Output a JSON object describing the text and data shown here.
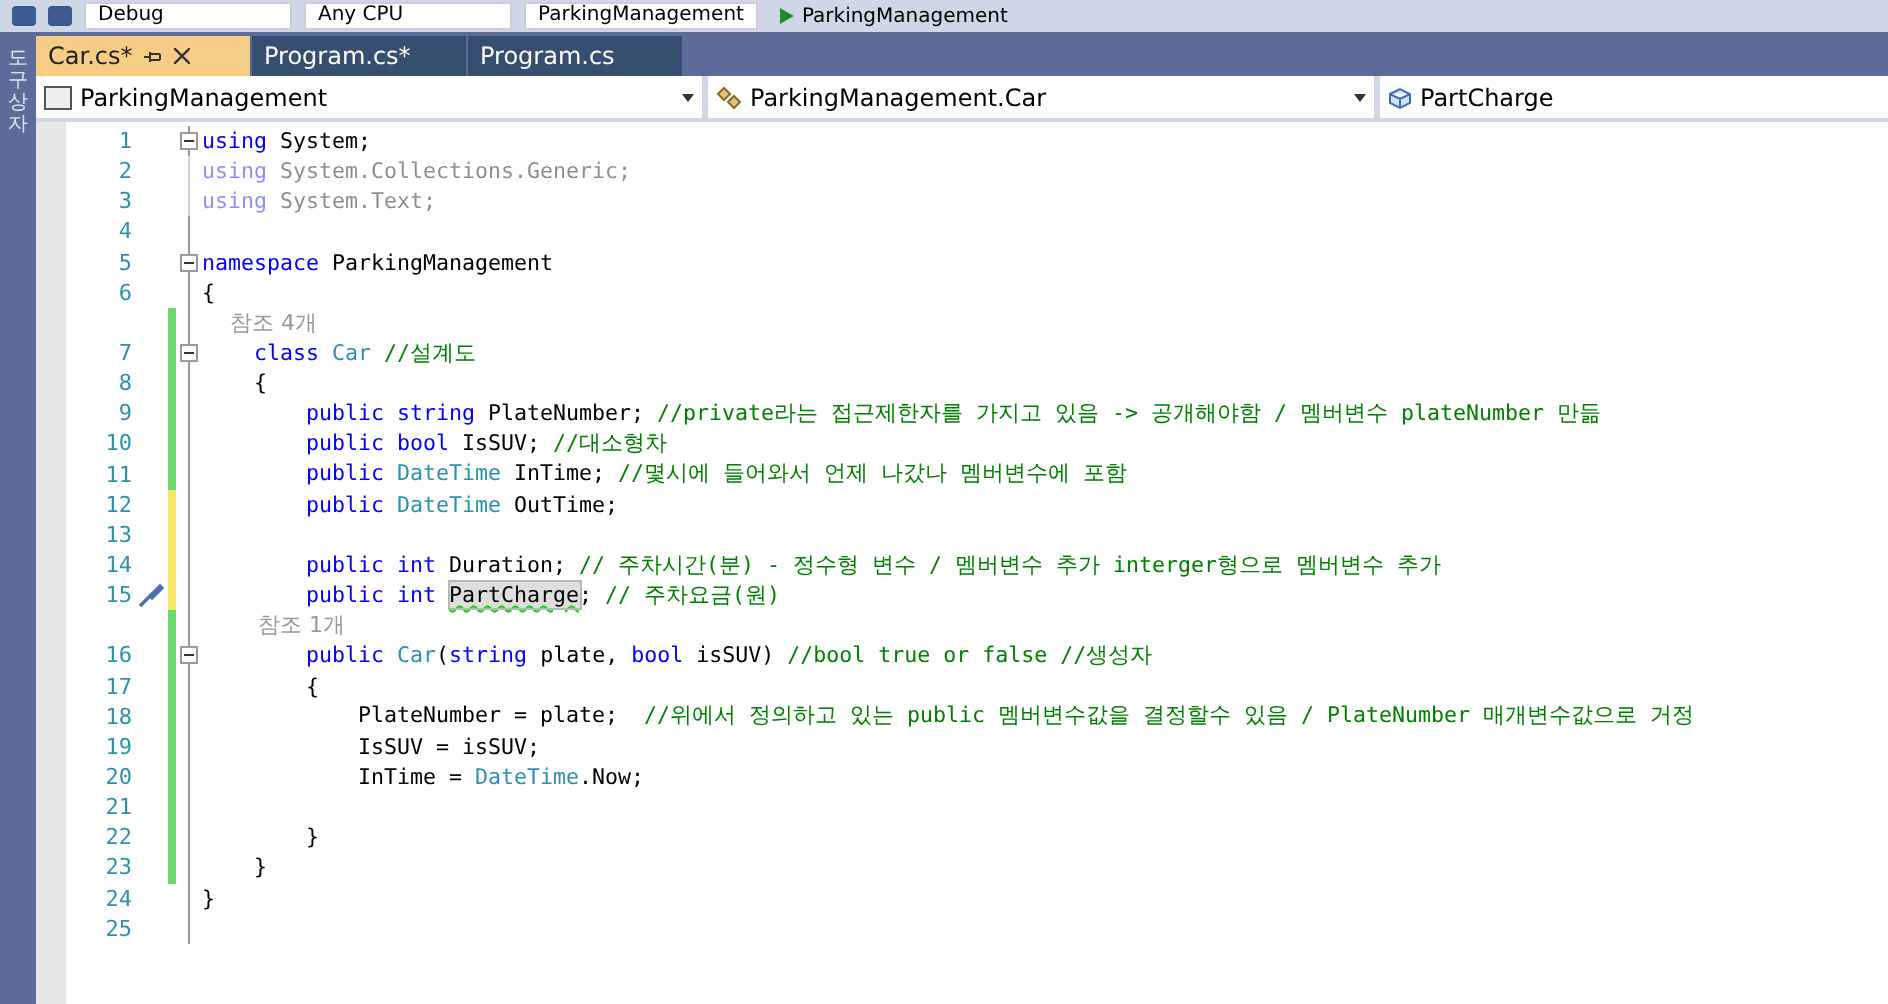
{
  "toolbar": {
    "items": [
      "Debug",
      "Any CPU",
      "ParkingManagement"
    ],
    "run_label": "ParkingManagement"
  },
  "side_panel": {
    "label": "도구 상자"
  },
  "tabs": [
    {
      "label": "Car.cs*",
      "selected": true
    },
    {
      "label": "Program.cs*",
      "selected": false
    },
    {
      "label": "Program.cs",
      "selected": false
    }
  ],
  "nav_bar": {
    "project": "ParkingManagement",
    "type": "ParkingManagement.Car",
    "member": "PartCharge"
  },
  "lines": [
    {
      "number": "1",
      "collapsible": true,
      "faded": false,
      "tokens": [
        {
          "kind": "kw",
          "text": "using"
        },
        {
          "kind": "plain",
          "text": " System;"
        }
      ]
    },
    {
      "number": "2",
      "collapsible": false,
      "faded": true,
      "tokens": [
        {
          "kind": "kw",
          "text": "using"
        },
        {
          "kind": "plain",
          "text": " System.Collections.Generic;"
        }
      ]
    },
    {
      "number": "3",
      "collapsible": false,
      "faded": true,
      "tokens": [
        {
          "kind": "kw",
          "text": "using"
        },
        {
          "kind": "plain",
          "text": " System.Text;"
        }
      ]
    },
    {
      "number": "4",
      "collapsible": false,
      "faded": false
    },
    {
      "number": "5",
      "collapsible": true,
      "faded": false,
      "tokens": [
        {
          "kind": "kw",
          "text": "namespace"
        },
        {
          "kind": "plain",
          "text": " ParkingManagement"
        }
      ]
    },
    {
      "number": "6",
      "collapsible": false,
      "faded": false,
      "tokens": [
        {
          "kind": "plain",
          "text": "{"
        }
      ]
    },
    {
      "color": "#6bd96b",
      "collapsible": false,
      "faded": false,
      "tokens": [
        {
          "kind": "lens",
          "text": "    참조 4개"
        }
      ]
    },
    {
      "number": "7",
      "color": "#6bd96b",
      "collapsible": true,
      "faded": false,
      "tokens": [
        {
          "kind": "kw",
          "text": "    class"
        },
        {
          "kind": "type",
          "text": " Car"
        },
        {
          "kind": "comment",
          "text": " //설계도"
        }
      ]
    },
    {
      "number": "8",
      "color": "#6bd96b",
      "collapsible": false,
      "faded": false,
      "tokens": [
        {
          "kind": "plain",
          "text": "    {"
        }
      ]
    },
    {
      "number": "9",
      "color": "#6bd96b",
      "collapsible": false,
      "faded": false,
      "tokens": [
        {
          "kind": "kw",
          "text": "        public string"
        },
        {
          "kind": "plain",
          "text": " PlateNumber;"
        },
        {
          "kind": "comment",
          "text": " //private라는 접근제한자를 가지고 있음 -> 공개해야함 / 멤버변수 plateNumber 만듦"
        }
      ]
    },
    {
      "number": "10",
      "color": "#6bd96b",
      "collapsible": false,
      "faded": false,
      "tokens": [
        {
          "kind": "kw",
          "text": "        public bool"
        },
        {
          "kind": "plain",
          "text": " IsSUV;"
        },
        {
          "kind": "comment",
          "text": " //대소형차"
        }
      ]
    },
    {
      "number": "11",
      "color": "#6bd96b",
      "collapsible": false,
      "faded": false,
      "tokens": [
        {
          "kind": "kw",
          "text": "        public"
        },
        {
          "kind": "type",
          "text": " DateTime"
        },
        {
          "kind": "plain",
          "text": " InTime;"
        },
        {
          "kind": "comment",
          "text": " //몇시에 들어와서 언제 나갔나 멤버변수에 포함"
        }
      ]
    },
    {
      "number": "12",
      "color": "#f7e766",
      "collapsible": false,
      "faded": false,
      "tokens": [
        {
          "kind": "kw",
          "text": "        public"
        },
        {
          "kind": "type",
          "text": " DateTime"
        },
        {
          "kind": "plain",
          "text": " OutTime;"
        }
      ]
    },
    {
      "number": "13",
      "color": "#f7e766",
      "collapsible": false,
      "faded": false
    },
    {
      "number": "14",
      "color": "#f7e766",
      "collapsible": false,
      "faded": false,
      "tokens": [
        {
          "kind": "kw",
          "text": "        public int"
        },
        {
          "kind": "plain",
          "text": " Duration;"
        },
        {
          "kind": "comment",
          "text": " // 주차시간(분) - 정수형 변수 / 멤버변수 추가 interger형으로 멤버변수 추가"
        }
      ]
    },
    {
      "number": "15",
      "color": "#f7e766",
      "collapsible": false,
      "faded": false,
      "quick_action": true,
      "tokens": [
        {
          "kind": "kw",
          "text": "        public int "
        },
        {
          "kind": "highlight",
          "text": "PartCharge"
        },
        {
          "kind": "plain",
          "text": ";"
        },
        {
          "kind": "comment",
          "text": " // 주차요금(원)"
        }
      ]
    },
    {
      "color": "#6bd96b",
      "collapsible": false,
      "faded": false,
      "tokens": [
        {
          "kind": "lens",
          "text": "        참조 1개"
        }
      ]
    },
    {
      "number": "16",
      "color": "#6bd96b",
      "collapsible": true,
      "faded": false,
      "tokens": [
        {
          "kind": "kw",
          "text": "        public"
        },
        {
          "kind": "type",
          "text": " Car"
        },
        {
          "kind": "plain",
          "text": "("
        },
        {
          "kind": "kw",
          "text": "string"
        },
        {
          "kind": "plain",
          "text": " plate, "
        },
        {
          "kind": "kw",
          "text": "bool"
        },
        {
          "kind": "plain",
          "text": " isSUV)"
        },
        {
          "kind": "comment",
          "text": " //bool true or false //생성자"
        }
      ]
    },
    {
      "number": "17",
      "color": "#6bd96b",
      "collapsible": false,
      "faded": false,
      "tokens": [
        {
          "kind": "plain",
          "text": "        {"
        }
      ]
    },
    {
      "number": "18",
      "color": "#6bd96b",
      "collapsible": false,
      "faded": false,
      "tokens": [
        {
          "kind": "plain",
          "text": "            PlateNumber = plate;"
        },
        {
          "kind": "comment",
          "text": "  //위에서 정의하고 있는 public 멤버변수값을 결정할수 있음 / PlateNumber 매개변수값으로 거정"
        }
      ]
    },
    {
      "number": "19",
      "color": "#6bd96b",
      "collapsible": false,
      "faded": false,
      "tokens": [
        {
          "kind": "plain",
          "text": "            IsSUV = isSUV;"
        }
      ]
    },
    {
      "number": "20",
      "color": "#6bd96b",
      "collapsible": false,
      "faded": false,
      "tokens": [
        {
          "kind": "plain",
          "text": "            InTime = "
        },
        {
          "kind": "type",
          "text": "DateTime"
        },
        {
          "kind": "plain",
          "text": ".Now;"
        }
      ]
    },
    {
      "number": "21",
      "color": "#6bd96b",
      "collapsible": false,
      "faded": false
    },
    {
      "number": "22",
      "color": "#6bd96b",
      "collapsible": false,
      "faded": false,
      "tokens": [
        {
          "kind": "plain",
          "text": "        }"
        }
      ]
    },
    {
      "number": "23",
      "color": "#6bd96b",
      "collapsible": false,
      "faded": false,
      "tokens": [
        {
          "kind": "plain",
          "text": "    }"
        }
      ]
    },
    {
      "number": "24",
      "collapsible": false,
      "faded": false,
      "tokens": [
        {
          "kind": "plain",
          "text": "}"
        }
      ]
    },
    {
      "number": "25",
      "collapsible": false,
      "faded": false
    }
  ]
}
